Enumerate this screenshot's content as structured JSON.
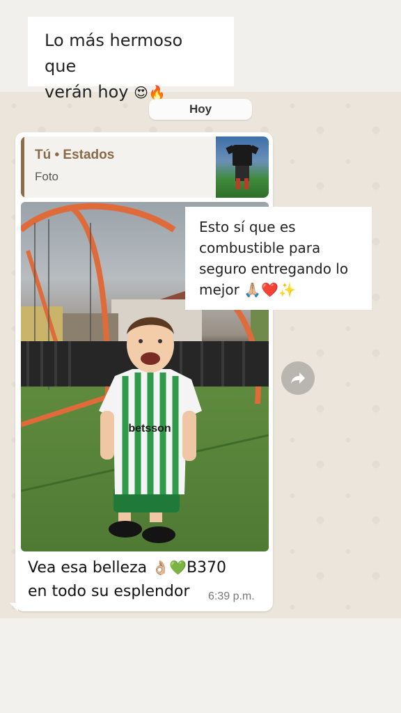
{
  "caption": {
    "line1": "Lo más hermoso que",
    "line2": "verán hoy",
    "emojis": "😍🔥"
  },
  "day_divider": "Hoy",
  "quote": {
    "title": "Tú • Estados",
    "subtitle": "Foto"
  },
  "overlay_text": {
    "line1": "Esto sí que es",
    "line2": "combustible para",
    "line3": "seguro entregando lo",
    "line4": "mejor",
    "emojis": "🙏🏼❤️✨"
  },
  "photo": {
    "jersey_text": "betsson"
  },
  "message": {
    "line1_a": "Vea esa belleza",
    "line1_emojis": "👌🏼💚",
    "line1_b": "B370",
    "line2": "en todo su esplendor",
    "time": "6:39 p.m."
  },
  "colors": {
    "accent_brown": "#8a6a46",
    "bubble": "#ffffff",
    "chat_background": "#ece5dc"
  },
  "icons": [
    "forward-icon"
  ]
}
